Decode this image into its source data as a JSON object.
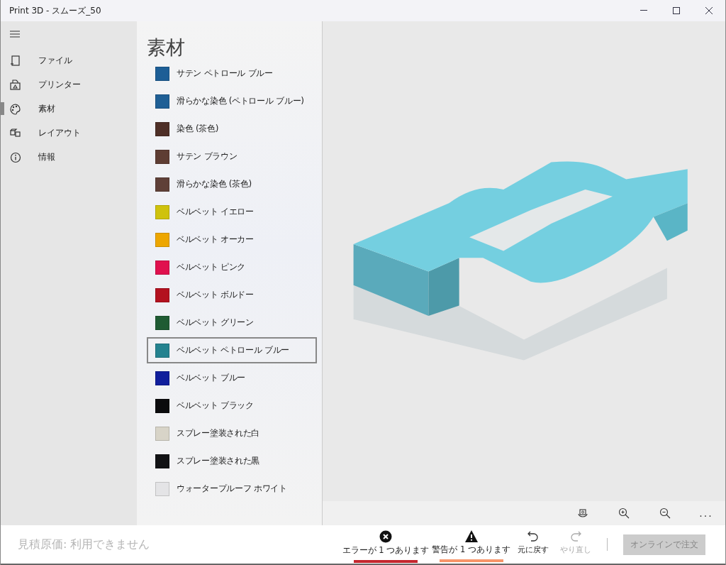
{
  "window": {
    "title": "Print 3D - スムーズ_50"
  },
  "nav": [
    {
      "label": "ファイル",
      "selected": false
    },
    {
      "label": "プリンター",
      "selected": false
    },
    {
      "label": "素材",
      "selected": true
    },
    {
      "label": "レイアウト",
      "selected": false
    },
    {
      "label": "情報",
      "selected": false
    }
  ],
  "materials": {
    "title": "素材",
    "items": [
      {
        "name": "サテン ペトロール ブルー",
        "color": "#1d5e96",
        "selected": false
      },
      {
        "name": "滑らかな染色 (ペトロール ブルー)",
        "color": "#1f5f95",
        "selected": false
      },
      {
        "name": "染色 (茶色)",
        "color": "#4e2f27",
        "selected": false
      },
      {
        "name": "サテン ブラウン",
        "color": "#5e3d33",
        "selected": false
      },
      {
        "name": "滑らかな染色 (茶色)",
        "color": "#5f4038",
        "selected": false
      },
      {
        "name": "ベルベット イエロー",
        "color": "#cfc20c",
        "selected": false
      },
      {
        "name": "ベルベット オーカー",
        "color": "#eda600",
        "selected": false
      },
      {
        "name": "ベルベット ピンク",
        "color": "#e0104e",
        "selected": false
      },
      {
        "name": "ベルベット ボルドー",
        "color": "#b3111f",
        "selected": false
      },
      {
        "name": "ベルベット グリーン",
        "color": "#1f5b33",
        "selected": false
      },
      {
        "name": "ベルベット ペトロール ブルー",
        "color": "#24828f",
        "selected": true
      },
      {
        "name": "ベルベット ブルー",
        "color": "#101e9c",
        "selected": false
      },
      {
        "name": "ベルベット ブラック",
        "color": "#0b0b0d",
        "selected": false
      },
      {
        "name": "スプレー塗装された白",
        "color": "#d8d4c8",
        "selected": false
      },
      {
        "name": "スプレー塗装された黒",
        "color": "#111214",
        "selected": false
      },
      {
        "name": "ウォータープルーフ ホワイト",
        "color": "#e4e4e6",
        "selected": false
      }
    ]
  },
  "viewport_more": "...",
  "cost": "見積原価: 利用できません",
  "status": [
    {
      "kind": "error",
      "label": "エラーが 1 つあります"
    },
    {
      "kind": "warning",
      "label": "警告が 1 つあります"
    }
  ],
  "actions": [
    {
      "kind": "undo",
      "label": "元に戻す",
      "disabled": false
    },
    {
      "kind": "redo",
      "label": "やり直し",
      "disabled": true
    }
  ],
  "order_button": {
    "label": "オンラインで注文",
    "disabled": true
  }
}
